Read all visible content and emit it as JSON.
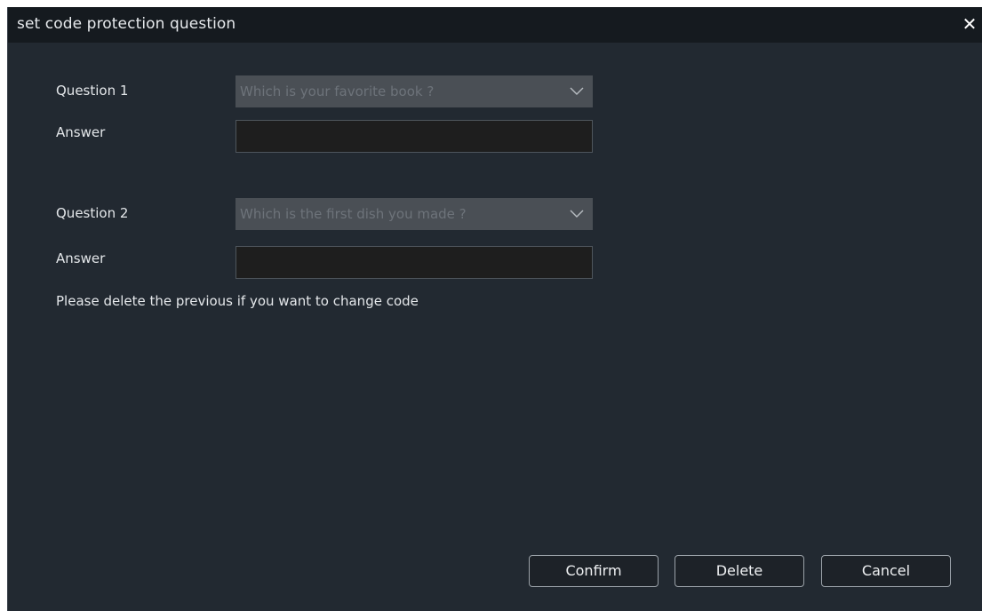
{
  "dialog": {
    "title": "set code protection question",
    "close_icon": "close-icon"
  },
  "question1": {
    "label": "Question 1",
    "selected": "Which is your favorite book ?",
    "answer_label": "Answer",
    "answer_value": ""
  },
  "question2": {
    "label": "Question 2",
    "selected": "Which is the first dish you made ?",
    "answer_label": "Answer",
    "answer_value": ""
  },
  "hint": "Please delete the previous if you want to change code",
  "buttons": {
    "confirm": "Confirm",
    "delete": "Delete",
    "cancel": "Cancel"
  },
  "colors": {
    "background": "#222931",
    "titlebar": "#151a1f",
    "select_bg": "#4a4f55",
    "input_bg": "#1e1e1e"
  }
}
